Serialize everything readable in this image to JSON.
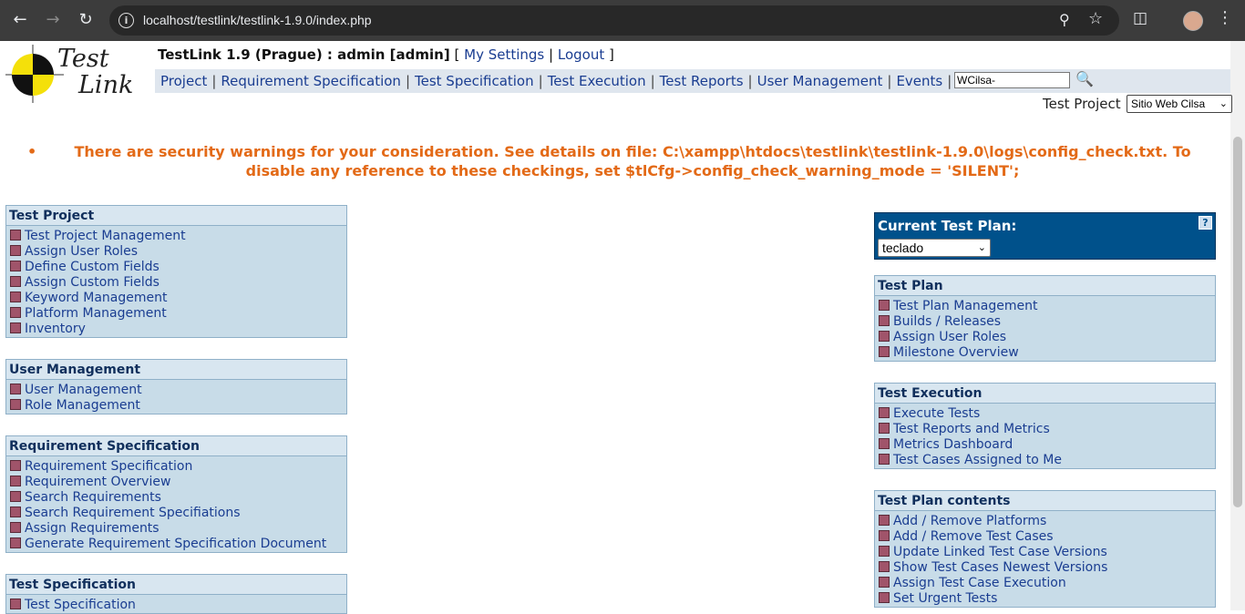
{
  "browser": {
    "url": "localhost/testlink/testlink-1.9.0/index.php"
  },
  "header": {
    "app_title": "TestLink 1.9 (Prague) : admin [admin]",
    "open_bracket": "[",
    "my_settings": "My Settings",
    "pipe": "|",
    "logout": "Logout",
    "close_bracket": "]",
    "logo_line1": "Test",
    "logo_line2": "Link"
  },
  "menu": {
    "items": [
      "Project",
      "Requirement Specification",
      "Test Specification",
      "Test Execution",
      "Test Reports",
      "User Management",
      "Events"
    ],
    "search_value": "WCilsa-"
  },
  "project": {
    "label": "Test Project",
    "selected": "Sitio Web Cilsa"
  },
  "warning": {
    "bullet": "•",
    "text": "There are security warnings for your consideration. See details on file: C:\\xampp\\htdocs\\testlink\\testlink-1.9.0\\logs\\config_check.txt. To disable any reference to these checkings, set $tlCfg->config_check_warning_mode = 'SILENT';"
  },
  "left_boxes": [
    {
      "title": "Test Project",
      "links": [
        "Test Project Management",
        "Assign User Roles",
        "Define Custom Fields",
        "Assign Custom Fields",
        "Keyword Management",
        "Platform Management",
        "Inventory"
      ]
    },
    {
      "title": "User Management",
      "links": [
        "User Management",
        "Role Management"
      ]
    },
    {
      "title": "Requirement Specification",
      "links": [
        "Requirement Specification",
        "Requirement Overview",
        "Search Requirements",
        "Search Requirement Specifiations",
        "Assign Requirements",
        "Generate Requirement Specification Document"
      ]
    },
    {
      "title": "Test Specification",
      "links": [
        "Test Specification"
      ]
    }
  ],
  "current_plan": {
    "label": "Current Test Plan:",
    "help": "?",
    "selected": "teclado"
  },
  "right_boxes": [
    {
      "title": "Test Plan",
      "links": [
        "Test Plan Management",
        "Builds / Releases",
        "Assign User Roles",
        "Milestone Overview"
      ]
    },
    {
      "title": "Test Execution",
      "links": [
        "Execute Tests",
        "Test Reports and Metrics",
        "Metrics Dashboard",
        "Test Cases Assigned to Me"
      ]
    },
    {
      "title": "Test Plan contents",
      "links": [
        "Add / Remove Platforms",
        "Add / Remove Test Cases",
        "Update Linked Test Case Versions",
        "Show Test Cases Newest Versions",
        "Assign Test Case Execution",
        "Set Urgent Tests"
      ]
    }
  ]
}
